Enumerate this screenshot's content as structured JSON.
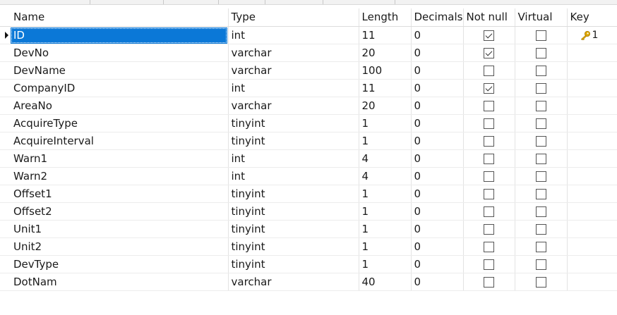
{
  "columns": {
    "name": "Name",
    "type": "Type",
    "length": "Length",
    "decimals": "Decimals",
    "not_null": "Not null",
    "virtual": "Virtual",
    "key": "Key"
  },
  "rows": [
    {
      "name": "ID",
      "type": "int",
      "length": "11",
      "decimals": "0",
      "not_null": true,
      "virtual": false,
      "key": "1",
      "selected": true
    },
    {
      "name": "DevNo",
      "type": "varchar",
      "length": "20",
      "decimals": "0",
      "not_null": true,
      "virtual": false,
      "key": ""
    },
    {
      "name": "DevName",
      "type": "varchar",
      "length": "100",
      "decimals": "0",
      "not_null": false,
      "virtual": false,
      "key": ""
    },
    {
      "name": "CompanyID",
      "type": "int",
      "length": "11",
      "decimals": "0",
      "not_null": true,
      "virtual": false,
      "key": ""
    },
    {
      "name": "AreaNo",
      "type": "varchar",
      "length": "20",
      "decimals": "0",
      "not_null": false,
      "virtual": false,
      "key": ""
    },
    {
      "name": "AcquireType",
      "type": "tinyint",
      "length": "1",
      "decimals": "0",
      "not_null": false,
      "virtual": false,
      "key": ""
    },
    {
      "name": "AcquireInterval",
      "type": "tinyint",
      "length": "1",
      "decimals": "0",
      "not_null": false,
      "virtual": false,
      "key": ""
    },
    {
      "name": "Warn1",
      "type": "int",
      "length": "4",
      "decimals": "0",
      "not_null": false,
      "virtual": false,
      "key": ""
    },
    {
      "name": "Warn2",
      "type": "int",
      "length": "4",
      "decimals": "0",
      "not_null": false,
      "virtual": false,
      "key": ""
    },
    {
      "name": "Offset1",
      "type": "tinyint",
      "length": "1",
      "decimals": "0",
      "not_null": false,
      "virtual": false,
      "key": ""
    },
    {
      "name": "Offset2",
      "type": "tinyint",
      "length": "1",
      "decimals": "0",
      "not_null": false,
      "virtual": false,
      "key": ""
    },
    {
      "name": "Unit1",
      "type": "tinyint",
      "length": "1",
      "decimals": "0",
      "not_null": false,
      "virtual": false,
      "key": ""
    },
    {
      "name": "Unit2",
      "type": "tinyint",
      "length": "1",
      "decimals": "0",
      "not_null": false,
      "virtual": false,
      "key": ""
    },
    {
      "name": "DevType",
      "type": "tinyint",
      "length": "1",
      "decimals": "0",
      "not_null": false,
      "virtual": false,
      "key": ""
    },
    {
      "name": "DotNam",
      "type": "varchar",
      "length": "40",
      "decimals": "0",
      "not_null": false,
      "virtual": false,
      "key": ""
    }
  ],
  "icons": {
    "key": "key-icon",
    "row_pointer": "row-pointer-icon"
  },
  "colors": {
    "selection": "#0b78d7",
    "key_icon": "#e0a800"
  }
}
